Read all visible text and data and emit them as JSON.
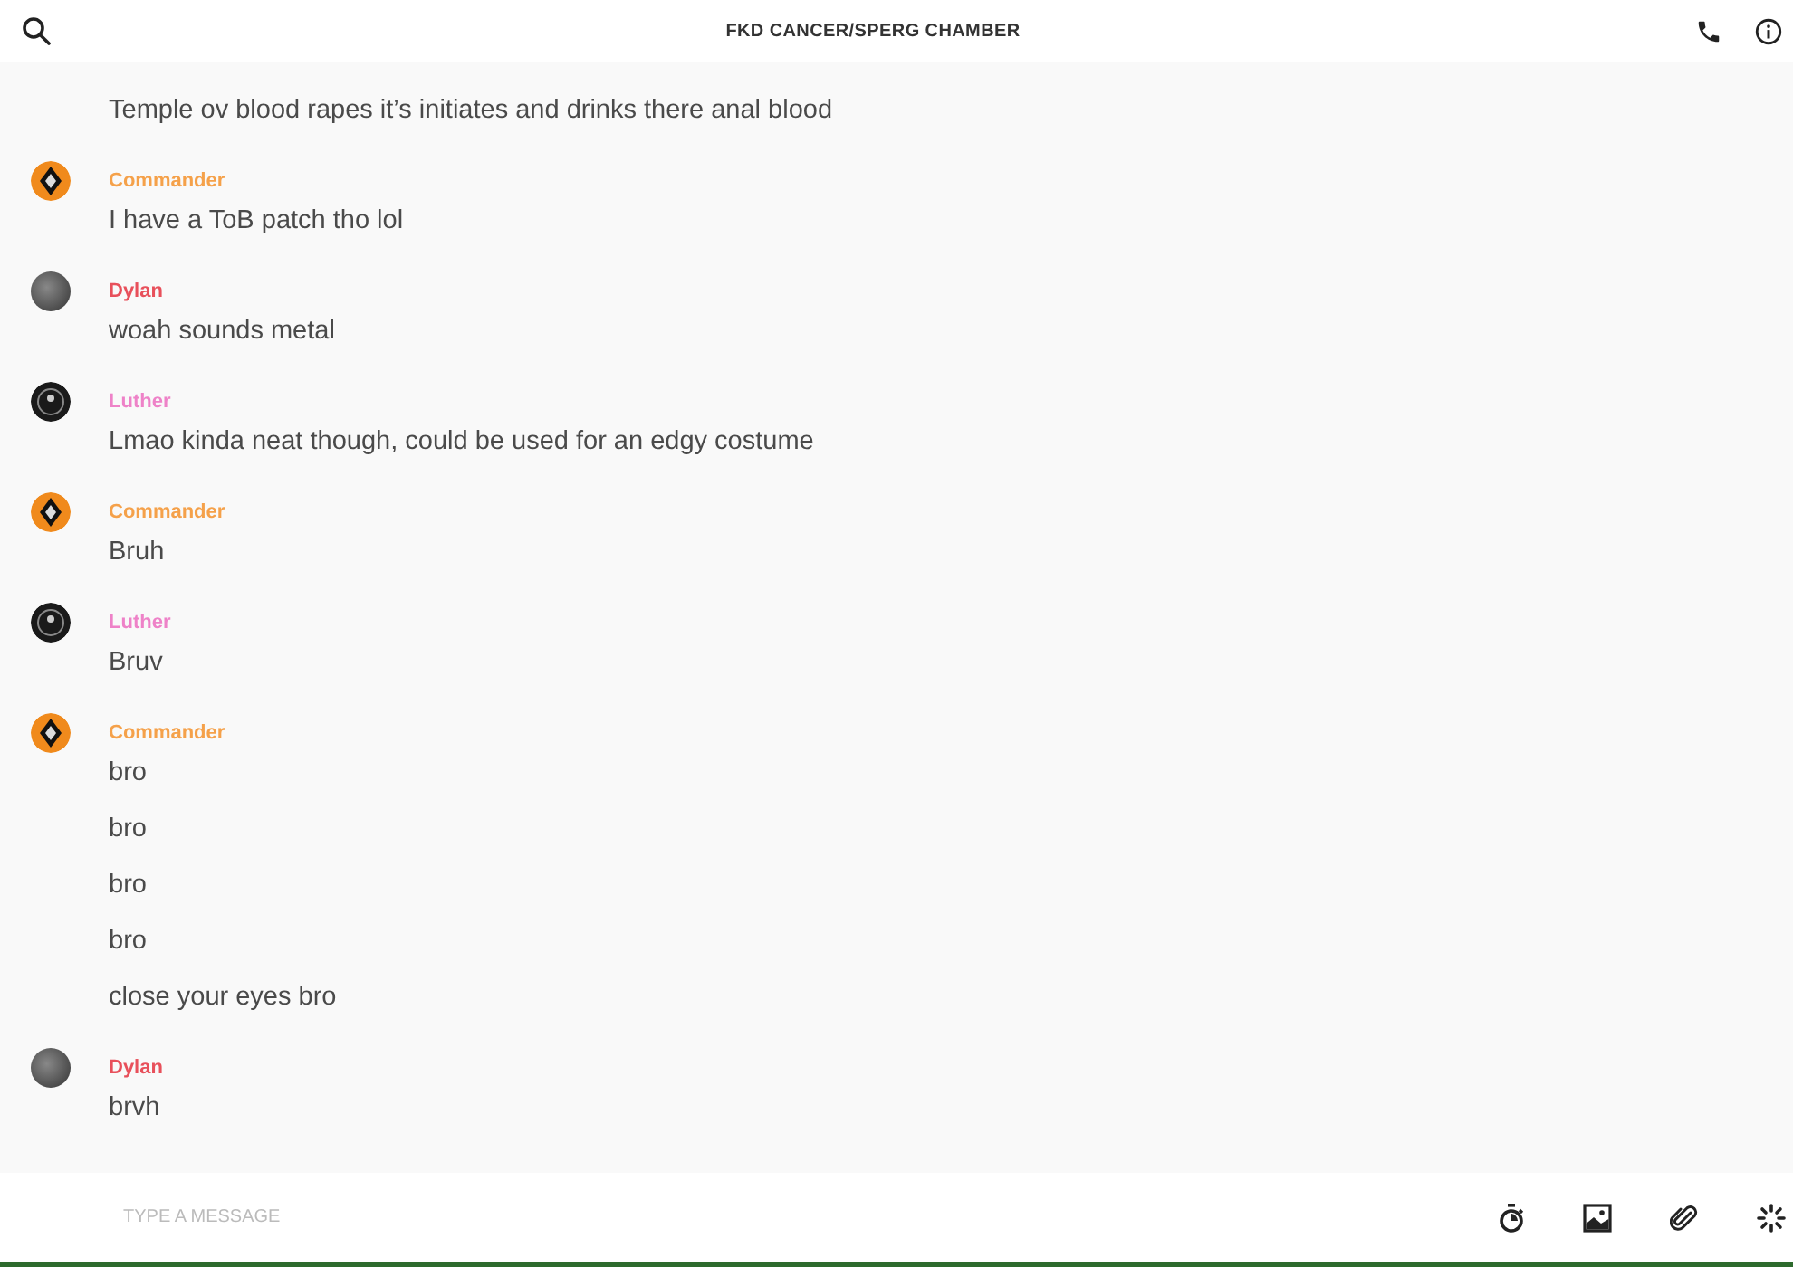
{
  "header": {
    "title": "FKD CANCER/SPERG CHAMBER"
  },
  "messages": [
    {
      "lines": [
        "Temple ov blood rapes it’s initiates and drinks there anal blood"
      ]
    },
    {
      "author": "Commander",
      "color": "#f5a14a",
      "kind": "emblem",
      "lines": [
        "I have a ToB patch tho lol"
      ]
    },
    {
      "author": "Dylan",
      "color": "#e8505b",
      "kind": "photo",
      "lines": [
        "woah sounds metal"
      ]
    },
    {
      "author": "Luther",
      "color": "#ee82c8",
      "kind": "dark",
      "lines": [
        "Lmao kinda neat though, could be used for an edgy costume"
      ]
    },
    {
      "author": "Commander",
      "color": "#f5a14a",
      "kind": "emblem",
      "lines": [
        "Bruh"
      ]
    },
    {
      "author": "Luther",
      "color": "#ee82c8",
      "kind": "dark",
      "lines": [
        "Bruv"
      ]
    },
    {
      "author": "Commander",
      "color": "#f5a14a",
      "kind": "emblem",
      "lines": [
        "bro",
        "bro",
        "bro",
        "bro",
        "close your eyes bro"
      ]
    },
    {
      "author": "Dylan",
      "color": "#e8505b",
      "kind": "photo",
      "lines": [
        "brvh"
      ]
    }
  ],
  "composer": {
    "placeholder": "TYPE A MESSAGE"
  }
}
